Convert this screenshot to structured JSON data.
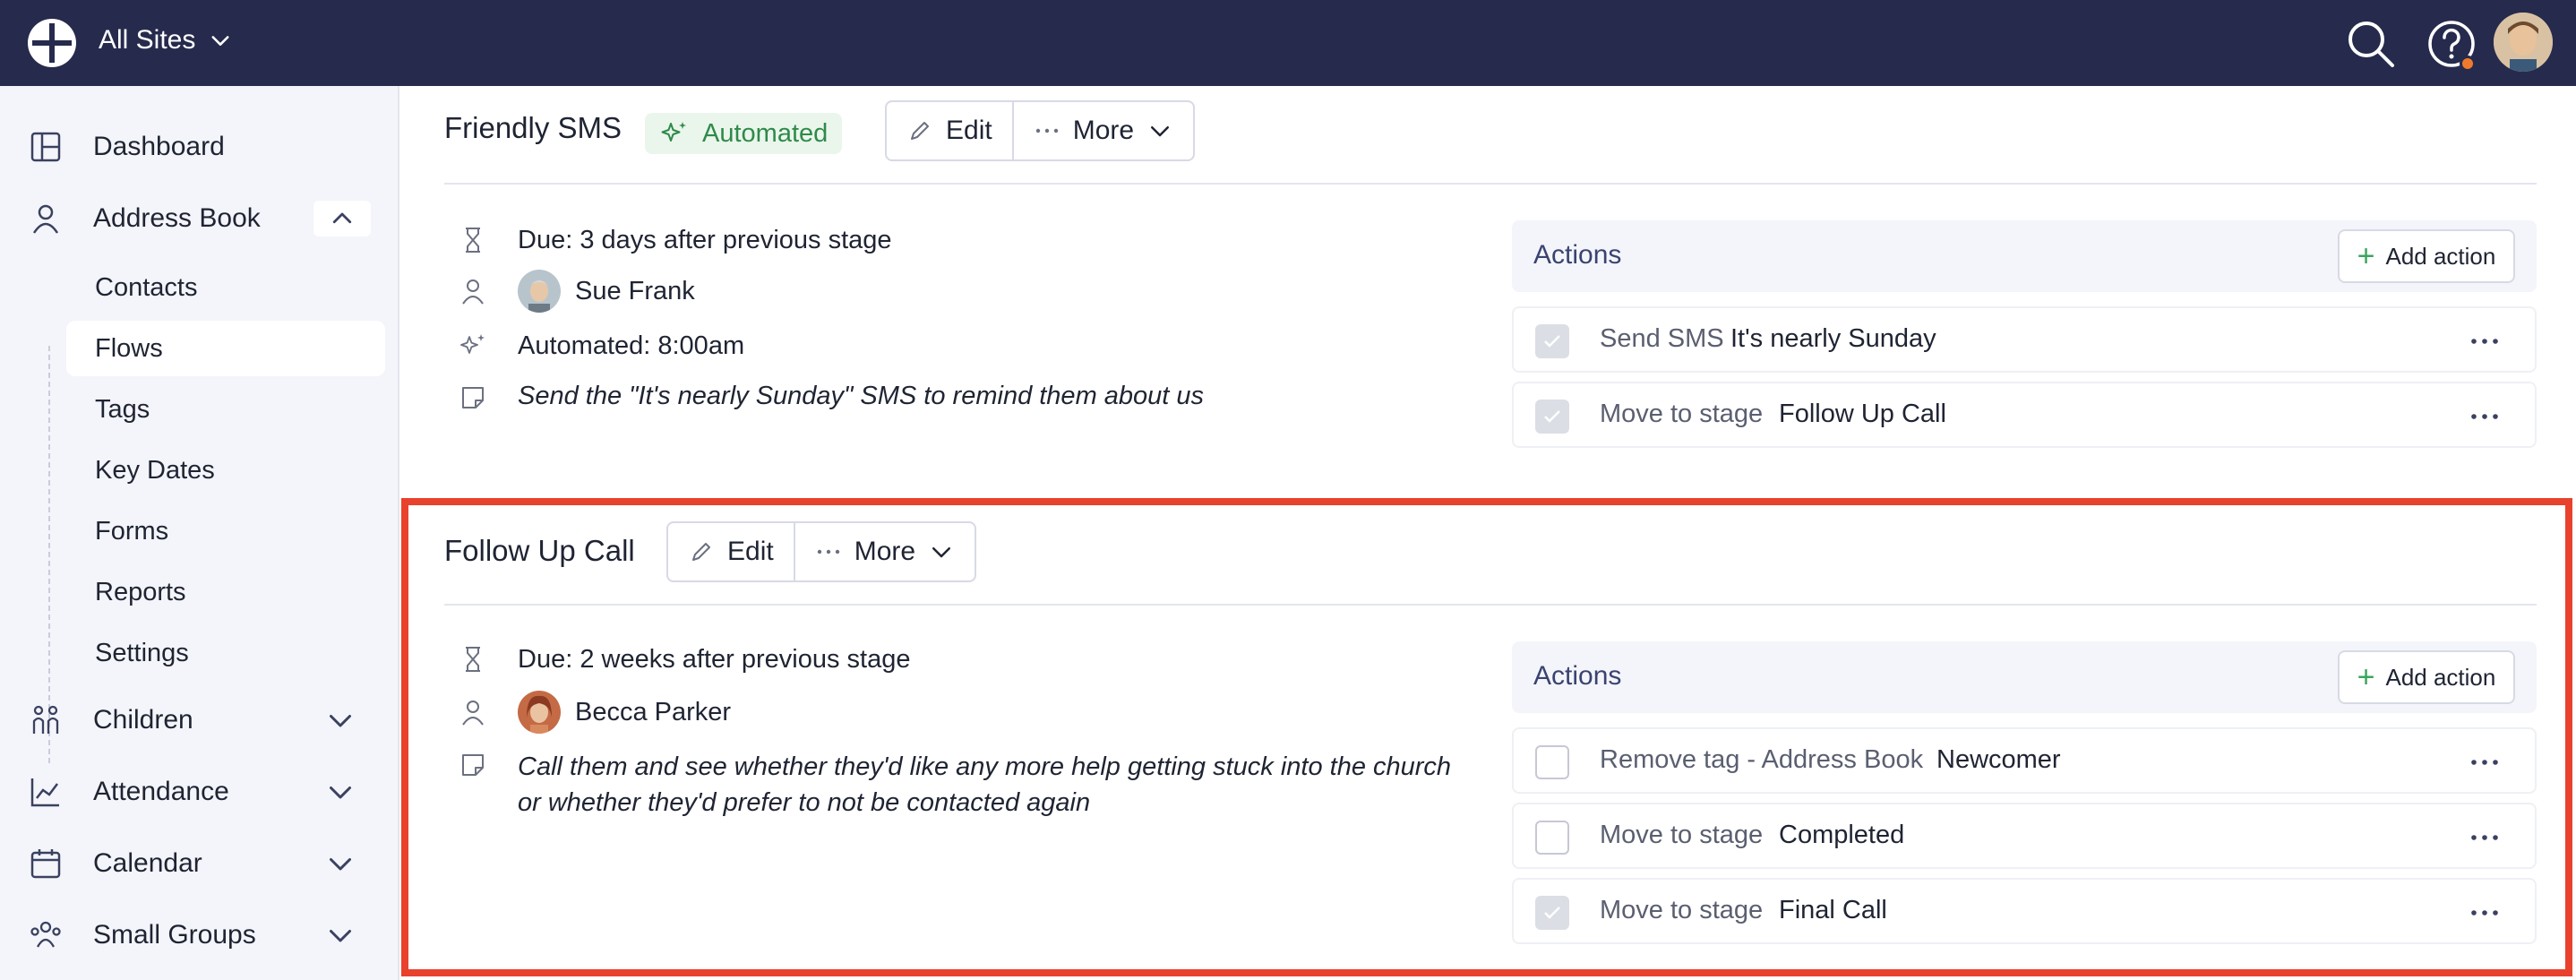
{
  "header": {
    "site_label": "All Sites"
  },
  "sidebar": {
    "items": [
      {
        "label": "Dashboard"
      },
      {
        "label": "Address Book"
      },
      {
        "label": "Children"
      },
      {
        "label": "Attendance"
      },
      {
        "label": "Calendar"
      },
      {
        "label": "Small Groups"
      }
    ],
    "sub_items": [
      {
        "label": "Contacts"
      },
      {
        "label": "Flows"
      },
      {
        "label": "Tags"
      },
      {
        "label": "Key Dates"
      },
      {
        "label": "Forms"
      },
      {
        "label": "Reports"
      },
      {
        "label": "Settings"
      }
    ],
    "active_sub_item": "Flows"
  },
  "stages": [
    {
      "title": "Friendly SMS",
      "badge": "Automated",
      "edit_label": "Edit",
      "more_label": "More",
      "due": "Due: 3 days after previous stage",
      "person": "Sue Frank",
      "automated": "Automated: 8:00am",
      "note": "Send the \"It's nearly Sunday\" SMS to remind them about us",
      "actions_title": "Actions",
      "add_action_label": "Add action",
      "actions": [
        {
          "type": "Send SMS",
          "value": "It's nearly Sunday",
          "checked": true
        },
        {
          "type": "Move to stage",
          "value": "Follow Up Call",
          "checked": true
        }
      ]
    },
    {
      "title": "Follow Up Call",
      "edit_label": "Edit",
      "more_label": "More",
      "due": "Due: 2 weeks after previous stage",
      "person": "Becca Parker",
      "note": "Call them and see whether they'd like any more help getting stuck into the church or whether they'd prefer to not be contacted again",
      "actions_title": "Actions",
      "add_action_label": "Add action",
      "actions": [
        {
          "type": "Remove tag - Address Book",
          "value": "Newcomer",
          "checked": false
        },
        {
          "type": "Move to stage",
          "value": "Completed",
          "checked": false
        },
        {
          "type": "Move to stage",
          "value": "Final Call",
          "checked": true
        }
      ]
    }
  ],
  "colors": {
    "topbar": "#262b4d",
    "sidebar": "#f4f5fa",
    "automated_badge": "#2f8a4a",
    "highlight": "#e8412c",
    "notification": "#f07a2c"
  }
}
